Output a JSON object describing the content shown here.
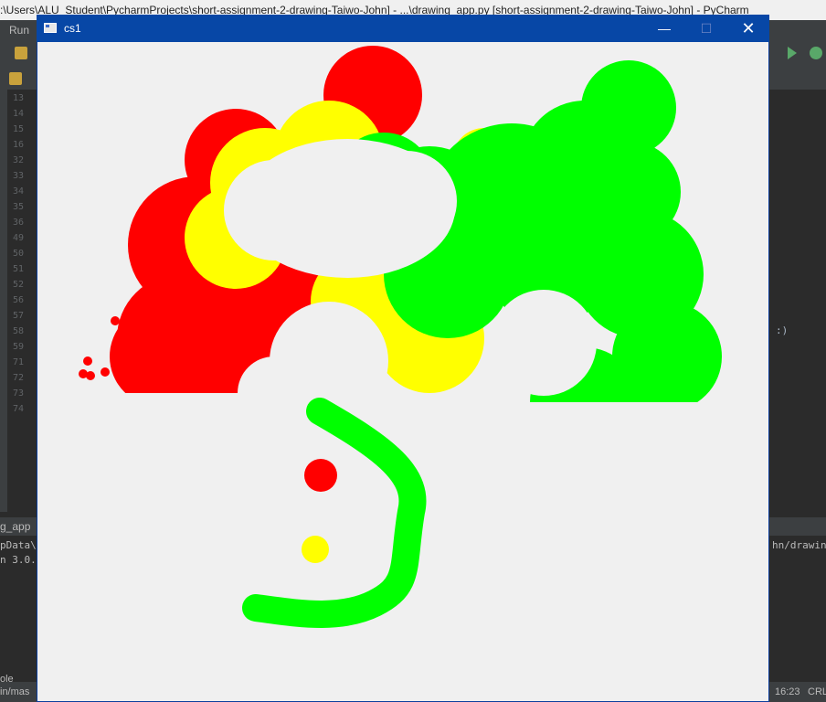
{
  "ide": {
    "window_title": ":\\Users\\ALU_Student\\PycharmProjects\\short-assignment-2-drawing-Taiwo-John] - ...\\drawing_app.py [short-assignment-2-drawing-Taiwo-John] - PyCharm",
    "menu_run": "Run",
    "line_numbers": [
      "13",
      "14",
      "15",
      "16",
      "32",
      "33",
      "34",
      "35",
      "36",
      "49",
      "50",
      "51",
      "52",
      "56",
      "57",
      "58",
      "59",
      "71",
      "72",
      "73",
      "74"
    ],
    "editor_right_fragment": ":)",
    "run_tab_label": "g_app",
    "run_line_1_left": "pData\\",
    "run_line_1_right": "hn/drawing",
    "run_line_2_left": "n 3.0.",
    "status_left": "ole",
    "status_branch": "in/mas",
    "status_time": "16:23",
    "status_crlf": "CRL"
  },
  "tk_window": {
    "title": "cs1",
    "minimize_glyph": "—",
    "maximize_glyph": "☐",
    "close_glyph": "✕"
  },
  "colors": {
    "red": "#ff0000",
    "yellow": "#ffff00",
    "green": "#00ff00",
    "canvas_bg": "#f0f0f0"
  }
}
